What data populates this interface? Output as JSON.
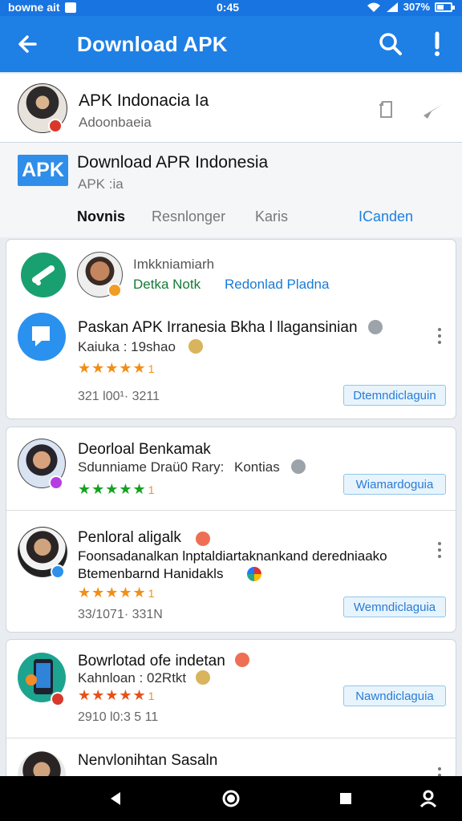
{
  "status": {
    "left": "bowne ait",
    "time": "0:45",
    "battery": "307%"
  },
  "app_bar": {
    "title": "Download APK",
    "back_icon": "arrow-back-icon",
    "search_icon": "search-icon",
    "alert_icon": "exclamation-icon",
    "color": "#1e7fe5"
  },
  "publisher": {
    "name": "APK Indonacia Ia",
    "subtitle": "Adoonbaeia"
  },
  "app": {
    "logo": "APK",
    "title": "Download APR Indonesia",
    "subtitle": "APK :ia"
  },
  "tabs": [
    {
      "label": "Novnis"
    },
    {
      "label": "Resnlonger"
    },
    {
      "label": "Karis"
    },
    {
      "label": "ICanden"
    }
  ],
  "cards": {
    "first": {
      "top_name": "Imkkniamiarh",
      "top_green": "Detka Notk",
      "top_blue": "Redonlad Pladna",
      "item_title": "Paskan APK Irranesia Bkha l llagansinian",
      "item_subtitle": "Kaiuka : 19shao",
      "rating": "1",
      "meta": "321 l00¹· 3211",
      "install": "Dtemndiclaguin"
    },
    "second": {
      "item1_title": "Deorloal Benkamak",
      "item1_subtitle": "Sdunniame Draü0 Rary:",
      "item1_extra": "Kontias",
      "item1_rating": "1",
      "item1_install": "Wiamardoguia",
      "item2_title": "Penloral aligalk",
      "item2_line2": "Foonsadanalkan lnptaldiartaknankand deredniaako",
      "item2_line3": "Btemenbarnd Hanidakls",
      "item2_rating": "1",
      "item2_meta": "33/1071· 331N",
      "item2_install": "Wemndiclaguia"
    },
    "third": {
      "item_title": "Bowrlotad ofe indetan",
      "item_subtitle": "Kahnloan : 02Rtkt",
      "rating": "1",
      "meta": "2910 l0:3 5 11",
      "install": "Nawndiclaguia",
      "next_title": "Nenvlonihtan Sasaln"
    }
  },
  "nav": {
    "back_icon": "back-triangle-icon",
    "home_icon": "home-circle-icon",
    "recents_icon": "recents-square-icon",
    "profile_icon": "profile-icon"
  },
  "colors": {
    "accent": "#1e7fe5",
    "star": "#f28e17",
    "green": "#157a36"
  }
}
